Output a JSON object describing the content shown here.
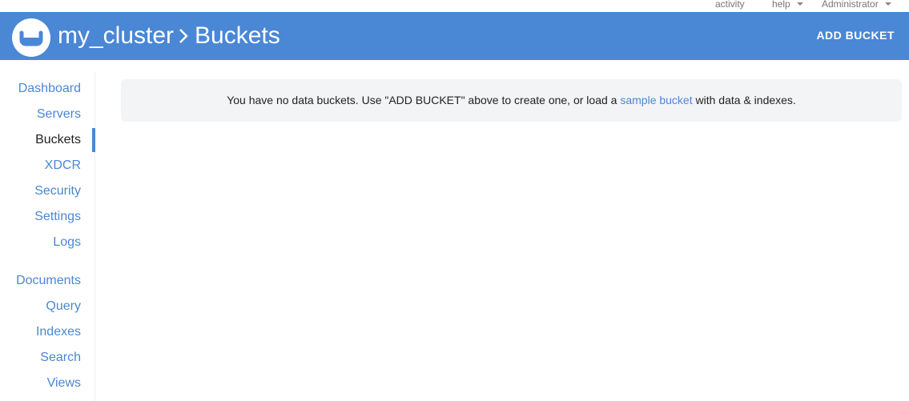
{
  "topbar": {
    "activity": "activity",
    "help": "help",
    "user": "Administrator"
  },
  "header": {
    "cluster": "my_cluster",
    "page": "Buckets",
    "add_bucket": "ADD BUCKET"
  },
  "sidebar": {
    "items": [
      {
        "label": "Dashboard"
      },
      {
        "label": "Servers"
      },
      {
        "label": "Buckets"
      },
      {
        "label": "XDCR"
      },
      {
        "label": "Security"
      },
      {
        "label": "Settings"
      },
      {
        "label": "Logs"
      },
      {
        "label": "Documents"
      },
      {
        "label": "Query"
      },
      {
        "label": "Indexes"
      },
      {
        "label": "Search"
      },
      {
        "label": "Views"
      }
    ]
  },
  "notice": {
    "before": "You have no data buckets. Use \"ADD BUCKET\" above to create one, or load a ",
    "link": "sample bucket",
    "after": " with data & indexes."
  },
  "colors": {
    "brand": "#4a87d5",
    "panel": "#f3f4f6"
  }
}
